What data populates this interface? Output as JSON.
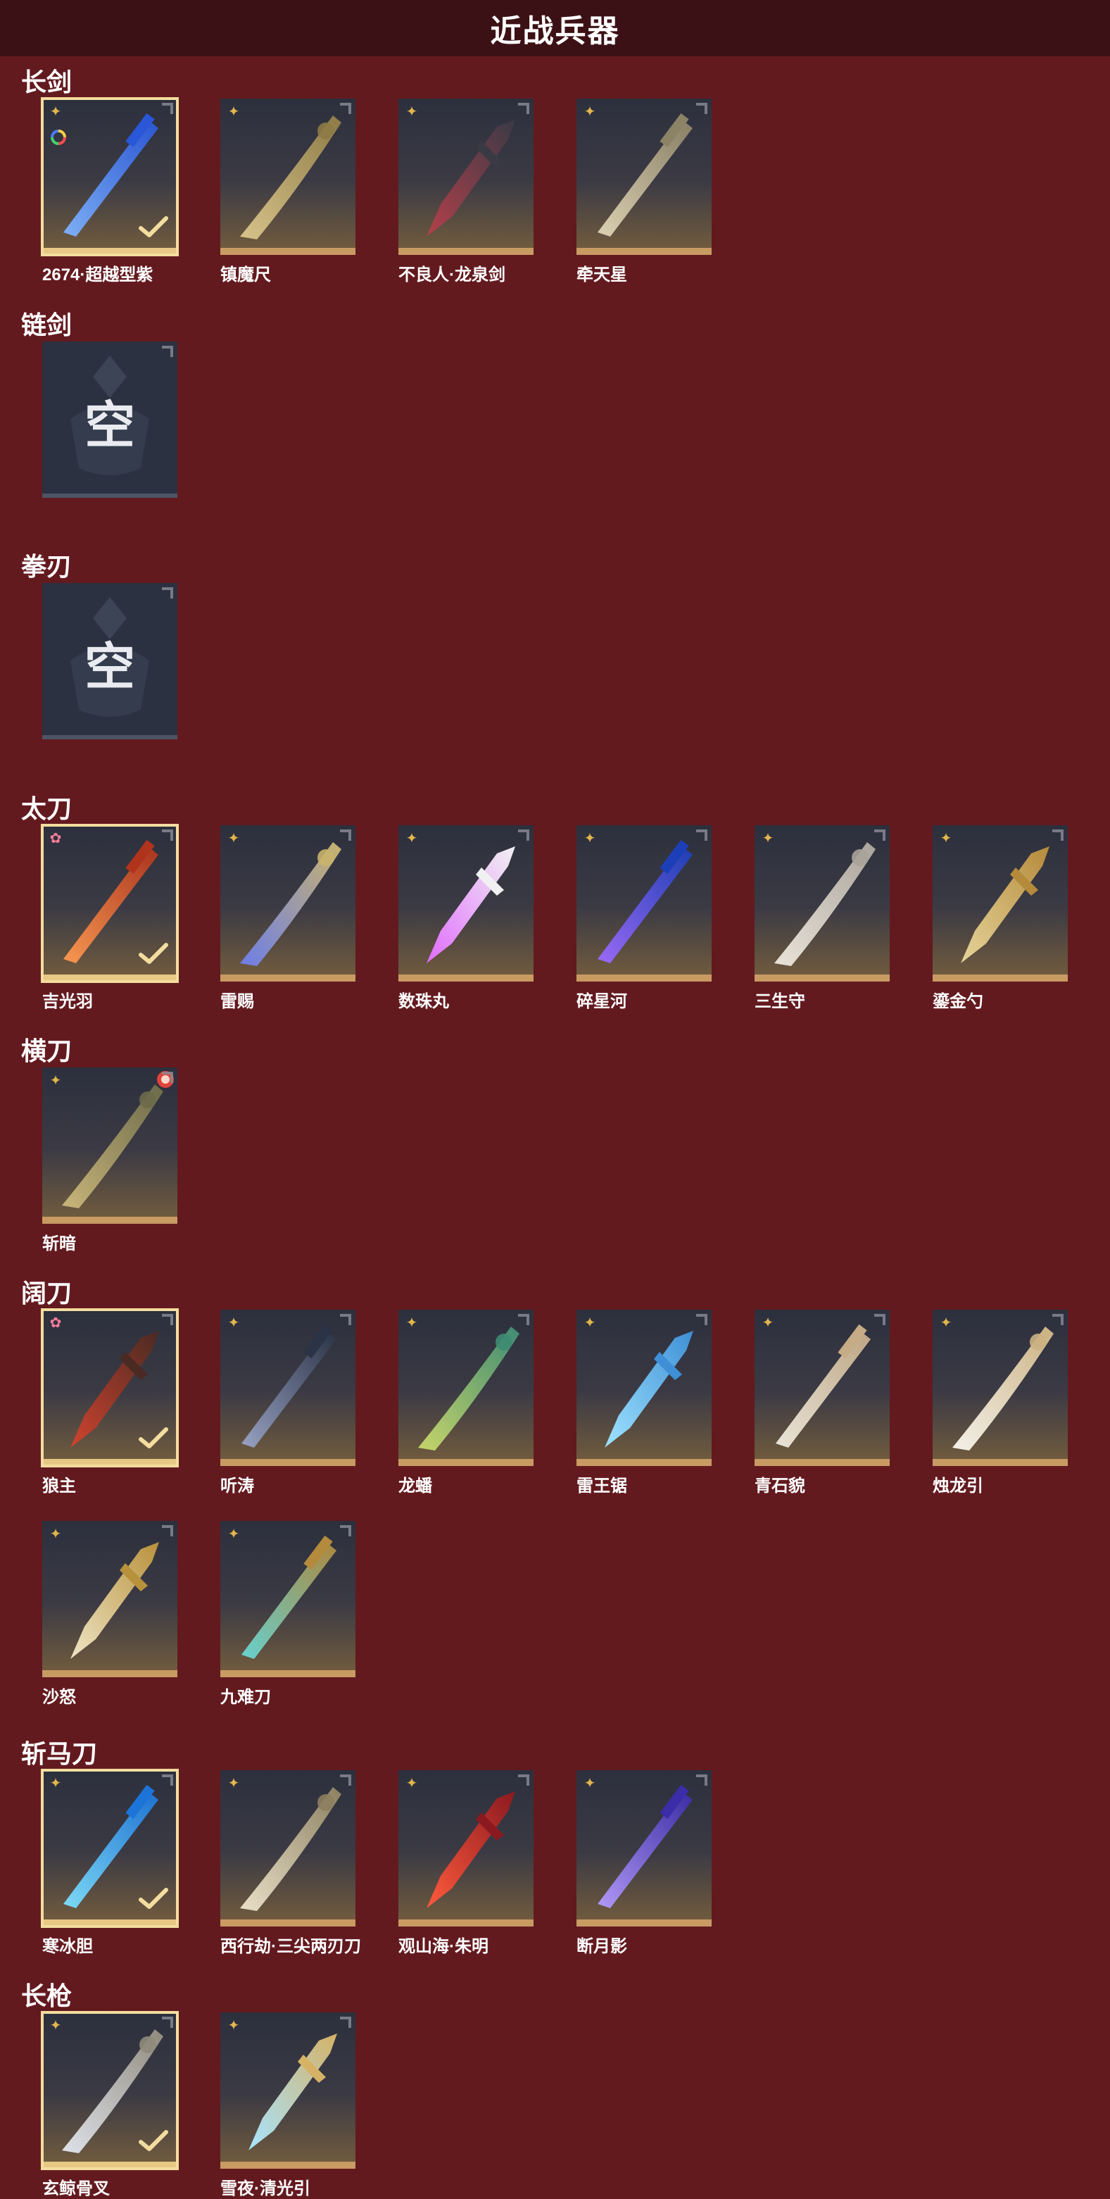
{
  "header": {
    "title": "近战兵器"
  },
  "empty_text": "空",
  "colors": {
    "background": "#631a1f",
    "header": "#3c1115",
    "card_border": "#c89b63",
    "selected_outline": "#f3dd9f",
    "badge_gold": "#e2b64c",
    "badge_pink": "#ff7d9a"
  },
  "sections": [
    {
      "title": "长剑",
      "items": [
        {
          "name": "2674·超越型紫",
          "badge": "gold-star-icon",
          "selected": true,
          "rainbow": true,
          "colors": [
            "#7fb4ff",
            "#2a57d8"
          ]
        },
        {
          "name": "镇魔尺",
          "badge": "gold-star-icon",
          "colors": [
            "#d7c38a",
            "#8d7a46"
          ]
        },
        {
          "name": "不良人·龙泉剑",
          "badge": "gold-star-icon",
          "colors": [
            "#b3404a",
            "#3a3a45"
          ]
        },
        {
          "name": "牵天星",
          "badge": "gold-star-icon",
          "colors": [
            "#e3d7b8",
            "#8c8266"
          ]
        }
      ]
    },
    {
      "title": "链剑",
      "items": [
        {
          "name": "",
          "empty": true
        }
      ]
    },
    {
      "title": "拳刃",
      "items": [
        {
          "name": "",
          "empty": true
        }
      ]
    },
    {
      "title": "太刀",
      "items": [
        {
          "name": "吉光羽",
          "badge": "pink-star-icon",
          "selected": true,
          "colors": [
            "#ff9b52",
            "#b0341b"
          ]
        },
        {
          "name": "雷赐",
          "badge": "gold-star-icon",
          "colors": [
            "#6d7ee8",
            "#c9b36c"
          ]
        },
        {
          "name": "数珠丸",
          "badge": "gold-star-icon",
          "colors": [
            "#e06cff",
            "#f1f1f1"
          ]
        },
        {
          "name": "碎星河",
          "badge": "gold-star-icon",
          "colors": [
            "#9d6bff",
            "#1c3fb8"
          ]
        },
        {
          "name": "三生守",
          "badge": "gold-star-icon",
          "colors": [
            "#e9e4da",
            "#a9a39a"
          ]
        },
        {
          "name": "鎏金勺",
          "badge": "gold-star-icon",
          "colors": [
            "#e5d49a",
            "#b58a3b"
          ]
        }
      ]
    },
    {
      "title": "横刀",
      "items": [
        {
          "name": "斩暗",
          "badge": "gold-star-icon",
          "redmark": true,
          "colors": [
            "#c9b57a",
            "#6b6a4a"
          ]
        }
      ]
    },
    {
      "title": "阔刀",
      "items": [
        {
          "name": "狼主",
          "badge": "pink-star-icon",
          "selected": true,
          "colors": [
            "#d0432f",
            "#4a2a22"
          ]
        },
        {
          "name": "听涛",
          "badge": "gold-star-icon",
          "colors": [
            "#9aa6c9",
            "#2b3346"
          ]
        },
        {
          "name": "龙蟠",
          "badge": "gold-star-icon",
          "colors": [
            "#c7d56a",
            "#3e8b73"
          ]
        },
        {
          "name": "雷王锯",
          "badge": "gold-star-icon",
          "colors": [
            "#9fe3ff",
            "#3e8fd6"
          ]
        },
        {
          "name": "青石貌",
          "badge": "gold-star-icon",
          "colors": [
            "#f1ece0",
            "#c5ab86"
          ]
        },
        {
          "name": "烛龙引",
          "badge": "gold-star-icon",
          "colors": [
            "#f4f1ea",
            "#cbb182"
          ]
        },
        {
          "name": "沙怒",
          "badge": "gold-star-icon",
          "colors": [
            "#efe5c5",
            "#b8913c"
          ]
        },
        {
          "name": "九难刀",
          "badge": "gold-star-icon",
          "colors": [
            "#67d8d6",
            "#b48b3d"
          ]
        }
      ]
    },
    {
      "title": "斩马刀",
      "items": [
        {
          "name": "寒冰胆",
          "badge": "gold-star-icon",
          "selected": true,
          "colors": [
            "#7fe1ff",
            "#1c74d8"
          ]
        },
        {
          "name": "西行劫·三尖两刃刀",
          "badge": "gold-star-icon",
          "colors": [
            "#e9e0c8",
            "#8c8060"
          ]
        },
        {
          "name": "观山海·朱明",
          "badge": "gold-star-icon",
          "colors": [
            "#ff5a3c",
            "#8b1920"
          ]
        },
        {
          "name": "断月影",
          "badge": "gold-star-icon",
          "colors": [
            "#b49cff",
            "#3b2ca8"
          ]
        }
      ]
    },
    {
      "title": "长枪",
      "items": [
        {
          "name": "玄鲸骨叉",
          "badge": "gold-star-icon",
          "selected": true,
          "colors": [
            "#dfe2ea",
            "#8f8a7c"
          ]
        },
        {
          "name": "雪夜·清光引",
          "badge": "gold-star-icon",
          "colors": [
            "#a8e4ff",
            "#d5b266"
          ]
        }
      ]
    }
  ]
}
